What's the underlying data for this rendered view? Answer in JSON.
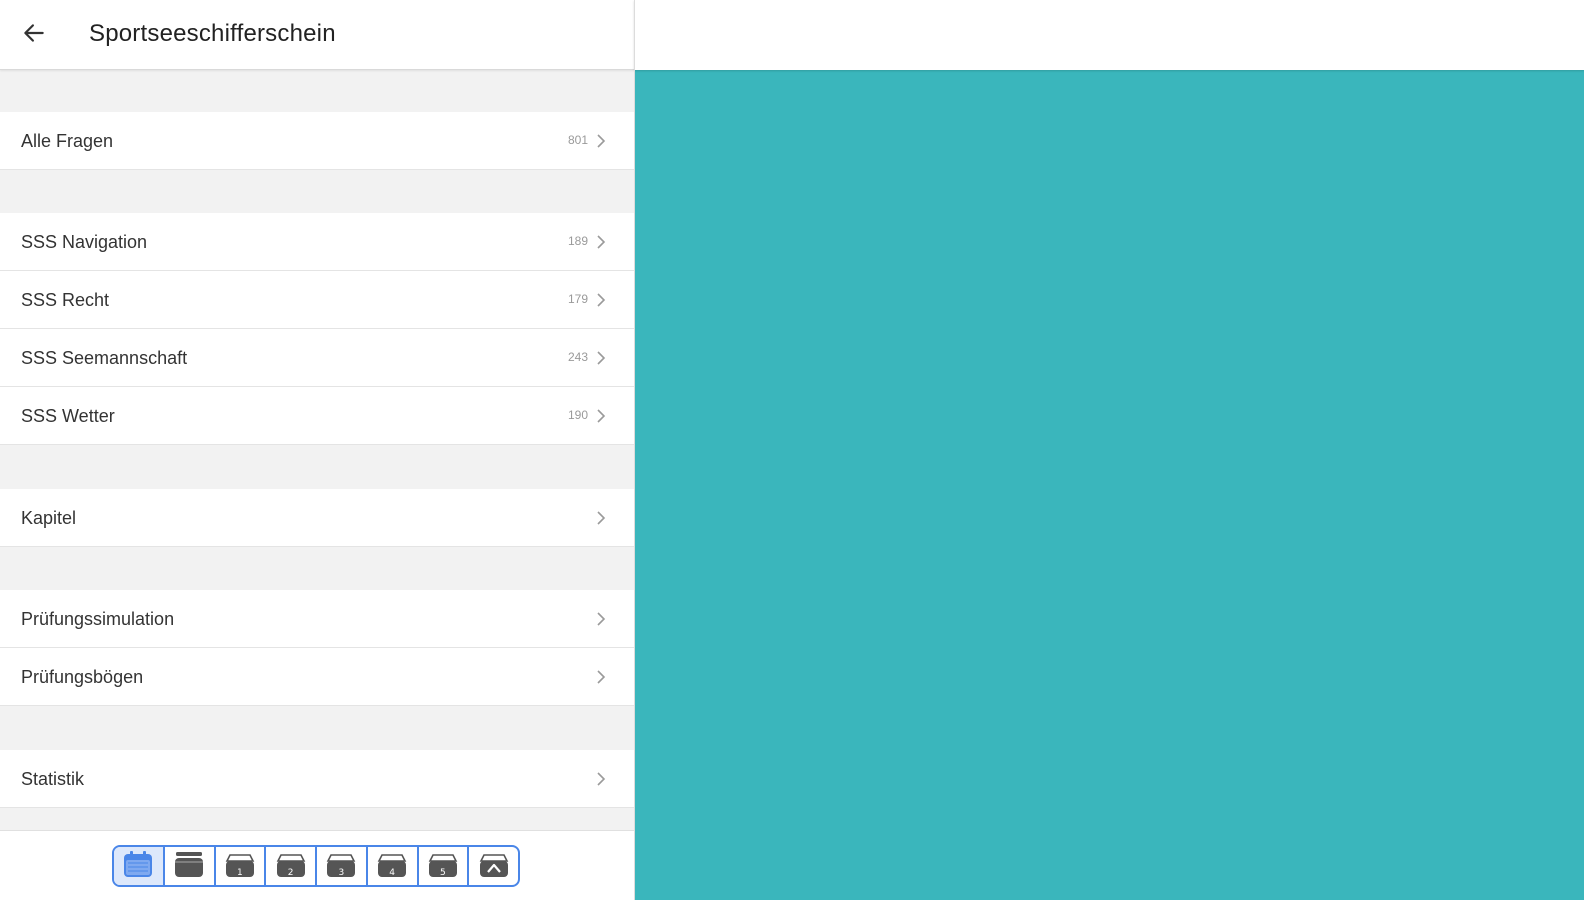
{
  "header": {
    "title": "Sportseeschifferschein",
    "back_icon": "arrow-left-icon"
  },
  "sections": [
    {
      "items": [
        {
          "label": "Alle Fragen",
          "count": "801"
        }
      ]
    },
    {
      "items": [
        {
          "label": "SSS Navigation",
          "count": "189"
        },
        {
          "label": "SSS Recht",
          "count": "179"
        },
        {
          "label": "SSS Seemannschaft",
          "count": "243"
        },
        {
          "label": "SSS Wetter",
          "count": "190"
        }
      ]
    },
    {
      "items": [
        {
          "label": "Kapitel",
          "count": ""
        }
      ]
    },
    {
      "items": [
        {
          "label": "Prüfungssimulation",
          "count": ""
        },
        {
          "label": "Prüfungsbögen",
          "count": ""
        }
      ]
    },
    {
      "items": [
        {
          "label": "Statistik",
          "count": ""
        }
      ]
    }
  ],
  "bottom_toolbar": {
    "buttons": [
      {
        "icon": "calendar-icon",
        "label": ""
      },
      {
        "icon": "box-all-icon",
        "label": ""
      },
      {
        "icon": "box-1-icon",
        "label": "1"
      },
      {
        "icon": "box-2-icon",
        "label": "2"
      },
      {
        "icon": "box-3-icon",
        "label": "3"
      },
      {
        "icon": "box-4-icon",
        "label": "4"
      },
      {
        "icon": "box-5-icon",
        "label": "5"
      },
      {
        "icon": "box-mastered-icon",
        "label": ""
      }
    ],
    "active_index": 0
  },
  "colors": {
    "content_teal": "#3ab6bc",
    "accent_blue": "#4a86e8",
    "icon_gray": "#555555"
  }
}
